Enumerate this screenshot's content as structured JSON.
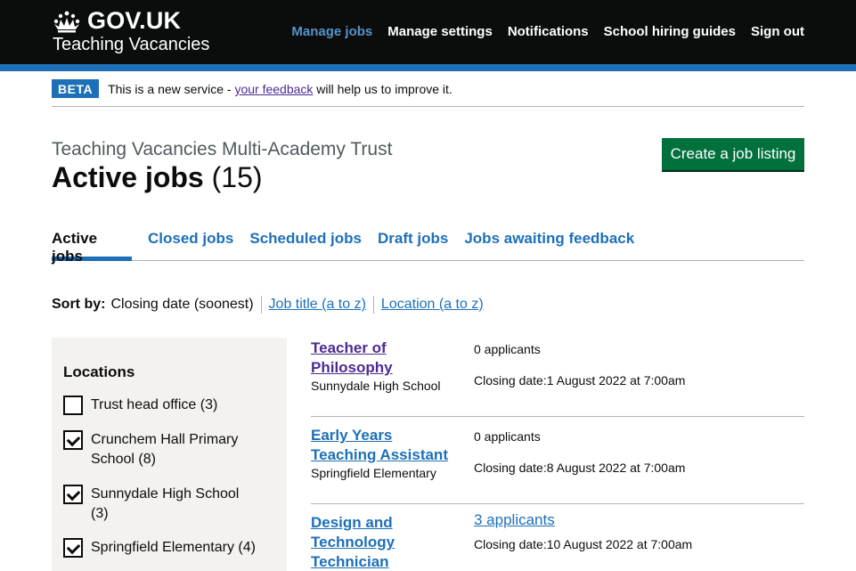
{
  "header": {
    "logo_text": "GOV.UK",
    "service_name": "Teaching Vacancies",
    "nav": [
      {
        "label": "Manage jobs",
        "active": true
      },
      {
        "label": "Manage settings",
        "active": false
      },
      {
        "label": "Notifications",
        "active": false
      },
      {
        "label": "School hiring guides",
        "active": false
      },
      {
        "label": "Sign out",
        "active": false
      }
    ]
  },
  "beta": {
    "tag": "BETA",
    "text_before": "This is a new service - ",
    "link": "your feedback",
    "text_after": " will help us to improve it."
  },
  "page": {
    "caption": "Teaching Vacancies Multi-Academy Trust",
    "title": "Active jobs",
    "count": "(15)",
    "create_button": "Create a job listing"
  },
  "tabs": [
    {
      "label": "Active jobs",
      "active": true
    },
    {
      "label": "Closed jobs",
      "active": false
    },
    {
      "label": "Scheduled jobs",
      "active": false
    },
    {
      "label": "Draft jobs",
      "active": false
    },
    {
      "label": "Jobs awaiting feedback",
      "active": false
    }
  ],
  "sort": {
    "label": "Sort by:",
    "current": "Closing date (soonest)",
    "options": [
      "Job title (a to z)",
      "Location (a to z)"
    ]
  },
  "filters": {
    "heading": "Locations",
    "items": [
      {
        "label": "Trust head office (3)",
        "checked": false
      },
      {
        "label": "Crunchem Hall Primary School (8)",
        "checked": true
      },
      {
        "label": "Sunnydale High School (3)",
        "checked": true
      },
      {
        "label": "Springfield Elementary (4)",
        "checked": true
      }
    ]
  },
  "jobs": [
    {
      "title": "Teacher of Philosophy",
      "school": "Sunnydale High School",
      "applicants": "0 applicants",
      "closing": "Closing date:1 August 2022 at 7:00am"
    },
    {
      "title": "Early Years Teaching Assistant",
      "school": "Springfield Elementary",
      "applicants": "0 applicants",
      "closing": "Closing date:8 August 2022 at 7:00am"
    },
    {
      "title": "Design and Technology Technician",
      "school": "",
      "applicants": "3 applicants",
      "closing": "Closing date:10 August 2022 at 7:00am"
    }
  ]
}
